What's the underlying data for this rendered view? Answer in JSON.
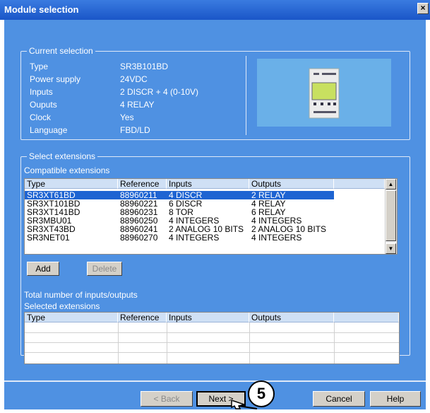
{
  "window": {
    "title": "Module selection"
  },
  "current_selection": {
    "legend": "Current selection",
    "fields": [
      {
        "label": "Type",
        "value": "SR3B101BD"
      },
      {
        "label": "Power supply",
        "value": "24VDC"
      },
      {
        "label": "Inputs",
        "value": "2 DISCR + 4 (0-10V)"
      },
      {
        "label": "Ouputs",
        "value": "4 RELAY"
      },
      {
        "label": "Clock",
        "value": "Yes"
      },
      {
        "label": "Language",
        "value": "FBD/LD"
      }
    ]
  },
  "extensions": {
    "legend": "Select extensions",
    "compatible_label": "Compatible extensions",
    "columns": [
      "Type",
      "Reference",
      "Inputs",
      "Outputs"
    ],
    "rows": [
      [
        "SR3XT61BD",
        "88960211",
        "4 DISCR",
        "2 RELAY"
      ],
      [
        "SR3XT101BD",
        "88960221",
        "6 DISCR",
        "4 RELAY"
      ],
      [
        "SR3XT141BD",
        "88960231",
        "8 TOR",
        "6 RELAY"
      ],
      [
        "SR3MBU01",
        "88960250",
        "4 INTEGERS",
        "4 INTEGERS"
      ],
      [
        "SR3XT43BD",
        "88960241",
        "2 ANALOG 10 BITS",
        "2 ANALOG 10 BITS"
      ],
      [
        "SR3NET01",
        "88960270",
        "4 INTEGERS",
        "4 INTEGERS"
      ]
    ],
    "selected_row": 0,
    "add_label": "Add",
    "delete_label": "Delete",
    "total_label": "Total number of inputs/outputs",
    "selected_label": "Selected extensions",
    "selected_columns": [
      "Type",
      "Reference",
      "Inputs",
      "Outputs"
    ]
  },
  "buttons": {
    "back": "< Back",
    "next": "Next >",
    "cancel": "Cancel",
    "help": "Help"
  },
  "callout": "5"
}
